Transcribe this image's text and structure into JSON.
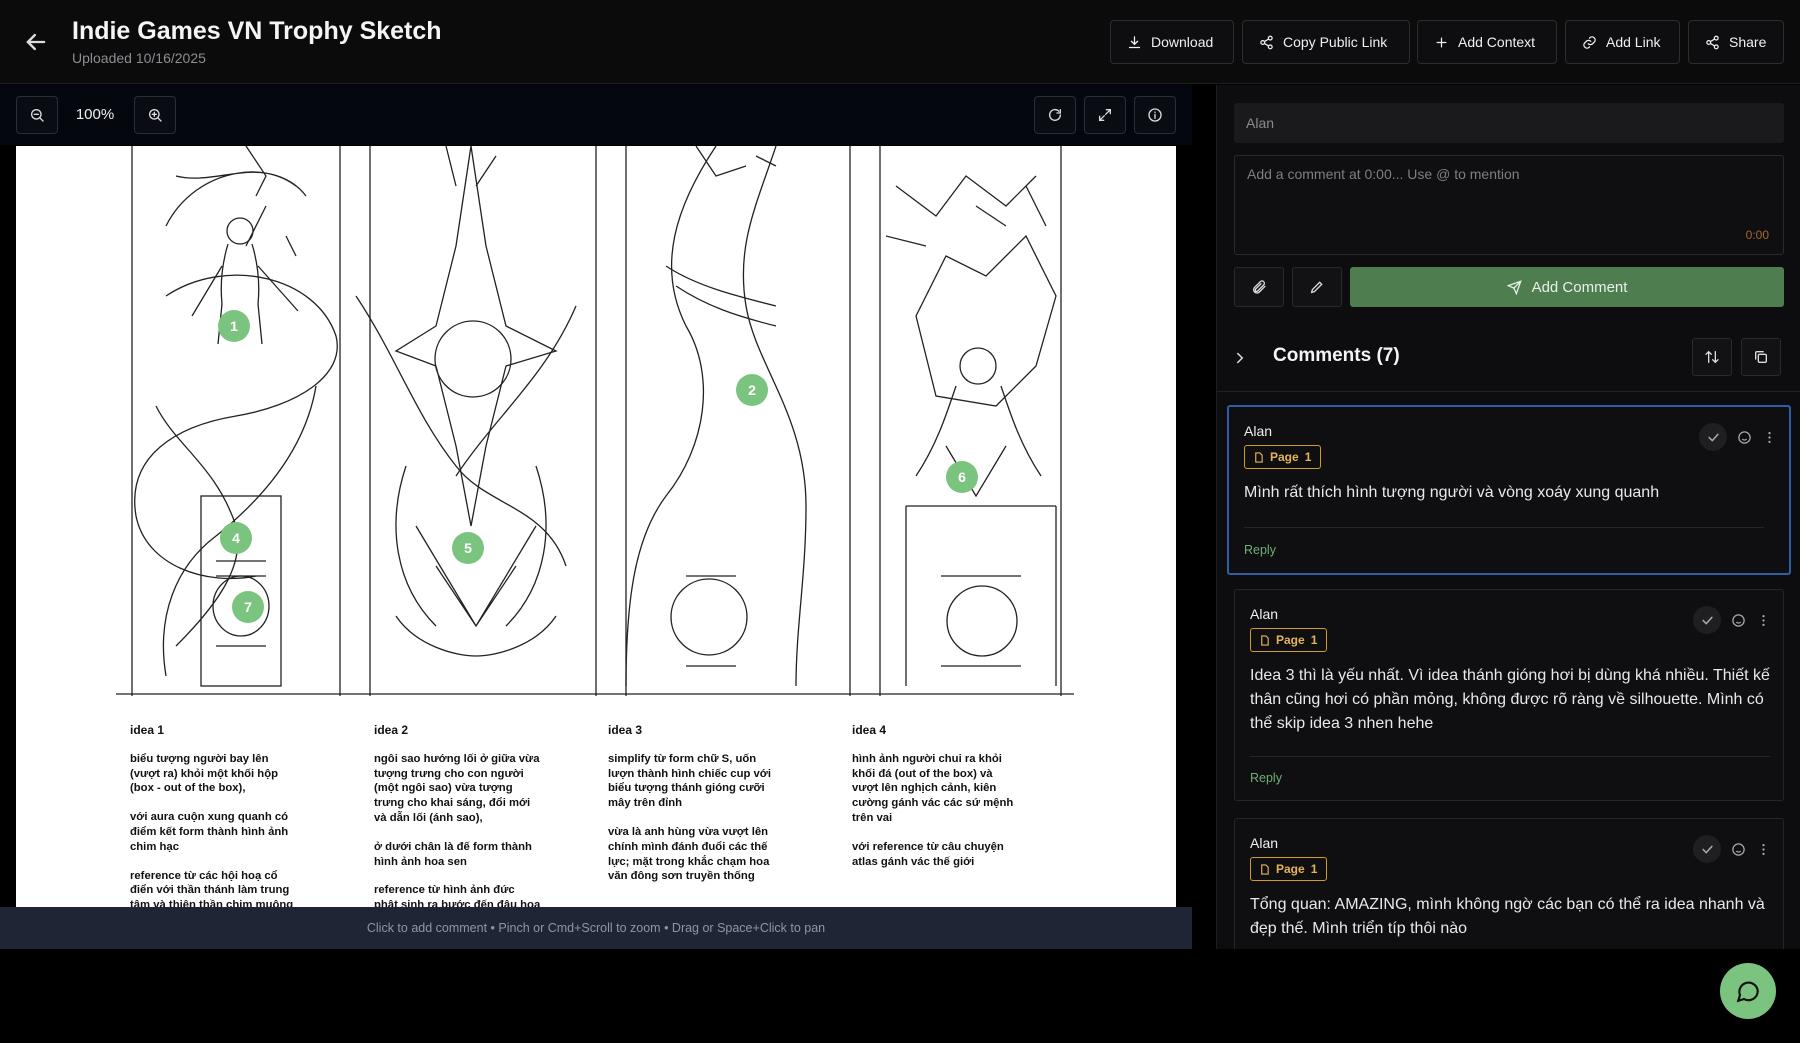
{
  "header": {
    "title": "Indie Games VN Trophy Sketch",
    "subtitle": "Uploaded 10/16/2025",
    "buttons": {
      "download": "Download",
      "copy_link": "Copy Public Link",
      "add_context": "Add Context",
      "add_link": "Add Link",
      "share": "Share"
    }
  },
  "viewer": {
    "zoom": "100%",
    "hint": "Click to add comment • Pinch or Cmd+Scroll to zoom • Drag or Space+Click to pan",
    "markers": [
      "1",
      "2",
      "4",
      "5",
      "6",
      "7"
    ],
    "ideas": [
      {
        "name": "idea 1",
        "paragraphs": [
          "biểu tượng người bay lên\n(vượt ra) khỏi một khối hộp\n(box - out of the box),",
          "với aura cuộn xung quanh có\nđiểm kết form thành hình ảnh\nchim hạc",
          "reference từ các hội hoạ cổ\nđiển với thần thánh làm trung\ntâm và thiên thần chim muông"
        ]
      },
      {
        "name": "idea 2",
        "paragraphs": [
          "ngôi sao hướng lối ở giữa vừa\ntượng trưng cho con người\n(một ngôi sao) vừa tượng\ntrưng cho khai sáng, đổi mới\nvà dẫn lối (ánh sao),",
          "ở dưới chân là đế form thành\nhình ảnh hoa sen",
          "reference từ hình ảnh đức\nphật sinh ra bước đến đâu hoa"
        ]
      },
      {
        "name": "idea 3",
        "paragraphs": [
          "simplify từ form chữ S, uốn\nlượn thành hình chiếc cup với\nbiểu tượng thánh gióng cưỡi\nmây trên đỉnh",
          "vừa là anh hùng vừa vượt lên\nchính mình đánh đuổi các thế\nlực; mặt trong khắc chạm hoa\nvăn đông sơn truyền thống"
        ]
      },
      {
        "name": "idea 4",
        "paragraphs": [
          "hình ảnh người chui ra khỏi\nkhối đá (out of the box) và\nvượt lên nghịch cảnh, kiên\ncường gánh vác các sứ mệnh\ntrên vai",
          "với reference từ câu chuyện\natlas gánh vác thế giới"
        ]
      }
    ]
  },
  "panel": {
    "name_value": "Alan",
    "comment_placeholder": "Add a comment at 0:00... Use @ to mention",
    "timestamp": "0:00",
    "add_comment": "Add Comment",
    "comments_header": "Comments (7)",
    "reply_label": "Reply",
    "comments": [
      {
        "author": "Alan",
        "page_label": "Page",
        "page_num": "1",
        "text": "Mình rất thích hình tượng người và vòng xoáy xung quanh"
      },
      {
        "author": "Alan",
        "page_label": "Page",
        "page_num": "1",
        "text": "Idea 3 thì là yếu nhất. Vì idea thánh gióng hơi bị dùng khá nhiều. Thiết kế thân cũng hơi có phần mỏng, không được rõ ràng về silhouette. Mình có thể skip idea 3 nhen hehe"
      },
      {
        "author": "Alan",
        "page_label": "Page",
        "page_num": "1",
        "text": "Tổng quan: AMAZING, mình không ngờ các bạn có thể ra idea nhanh và đẹp thế. Mình triển típ thôi nào"
      }
    ]
  }
}
